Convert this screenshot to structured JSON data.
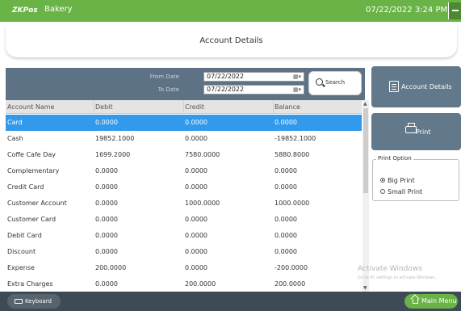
{
  "app": {
    "logo": "ZKPos",
    "store_name": "Bakery",
    "datetime": "07/22/2022 3:24 PM"
  },
  "page": {
    "title": "Account Details"
  },
  "filter": {
    "from_label": "From Date",
    "to_label": "To Date",
    "from_value": "07/22/2022",
    "to_value": "07/22/2022",
    "search_label": "Search"
  },
  "table": {
    "headers": [
      "Account Name",
      "Debit",
      "Credit",
      "Balance"
    ],
    "rows": [
      {
        "name": "Card",
        "debit": "0.0000",
        "credit": "0.0000",
        "balance": "0.0000",
        "selected": true
      },
      {
        "name": "Cash",
        "debit": "19852.1000",
        "credit": "0.0000",
        "balance": "-19852.1000"
      },
      {
        "name": "Coffe Cafe Day",
        "debit": "1699.2000",
        "credit": "7580.0000",
        "balance": "5880.8000"
      },
      {
        "name": "Complementary",
        "debit": "0.0000",
        "credit": "0.0000",
        "balance": "0.0000"
      },
      {
        "name": "Credit Card",
        "debit": "0.0000",
        "credit": "0.0000",
        "balance": "0.0000"
      },
      {
        "name": "Customer Account",
        "debit": "0.0000",
        "credit": "1000.0000",
        "balance": "1000.0000"
      },
      {
        "name": "Customer Card",
        "debit": "0.0000",
        "credit": "0.0000",
        "balance": "0.0000"
      },
      {
        "name": "Debit  Card",
        "debit": "0.0000",
        "credit": "0.0000",
        "balance": "0.0000"
      },
      {
        "name": "Discount",
        "debit": "0.0000",
        "credit": "0.0000",
        "balance": "0.0000"
      },
      {
        "name": "Expense",
        "debit": "200.0000",
        "credit": "0.0000",
        "balance": "-200.0000"
      },
      {
        "name": "Extra Charges",
        "debit": "0.0000",
        "credit": "200.0000",
        "balance": "200.0000"
      }
    ]
  },
  "side": {
    "account_details_label": "Account Details",
    "print_label": "Print",
    "print_option_title": "Print Option",
    "big_print_label": "Big Print",
    "small_print_label": "Small Print",
    "selected_print_option": "Big Print"
  },
  "watermark": {
    "line1": "Activate Windows",
    "line2": "Go to PC settings to activate Windows."
  },
  "bottom": {
    "keyboard_label": "Keyboard",
    "main_menu_label": "Main Menu"
  },
  "colors": {
    "topbar": "#6ab346",
    "filterbar": "#5d7284",
    "selected_row": "#3399ea",
    "side_button": "#61798a",
    "bottombar": "#3e4a55"
  }
}
